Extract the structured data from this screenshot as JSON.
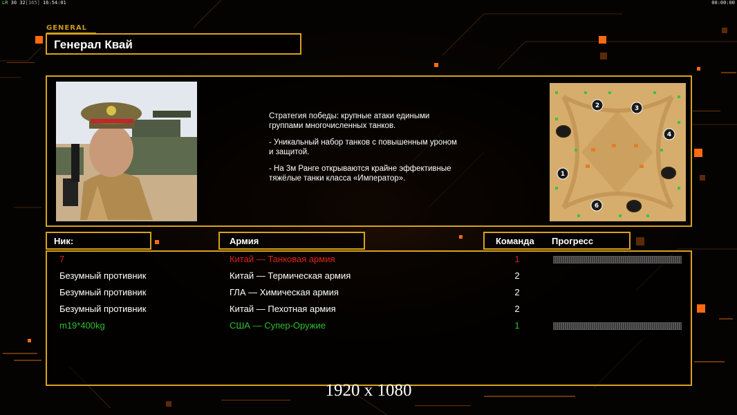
{
  "hud": {
    "fps_label": "LR",
    "fps": "30",
    "ping": "32",
    "ping_extra": "[165]",
    "clock": "16:54:01",
    "timer": "00:00:00"
  },
  "general": {
    "tag": "GENERAL",
    "name": "Генерал Квай",
    "description": [
      "Стратегия победы: крупные атаки едиными\n группами многочисленных танков.",
      "- Уникальный набор танков с повышенным уроном\n и защитой.",
      "- На 3м Ранге открываются крайне эффективные\n тяжёлые танки класса «Император»."
    ]
  },
  "minimap": {
    "slot_numbers": [
      "1",
      "2",
      "3",
      "4",
      "6"
    ]
  },
  "columns": {
    "nick": "Ник:",
    "army": "Армия",
    "team": "Команда",
    "progress": "Прогресс"
  },
  "players": [
    {
      "nick": "7",
      "army": "Китай — Танковая армия",
      "team": "1",
      "color": "#e0201a",
      "progress": 0
    },
    {
      "nick": "Безумный противник",
      "army": "Китай — Термическая армия",
      "team": "2",
      "color": "#ffffff"
    },
    {
      "nick": "Безумный противник",
      "army": "ГЛА — Химическая армия",
      "team": "2",
      "color": "#ffffff"
    },
    {
      "nick": "Безумный противник",
      "army": "Китай — Пехотная армия",
      "team": "2",
      "color": "#ffffff"
    },
    {
      "nick": "m19*400kg",
      "army": "США — Супер-Оружие",
      "team": "1",
      "color": "#2fbf2f",
      "progress": 0
    }
  ],
  "overlay": {
    "resolution": "1920 x 1080"
  },
  "colors": {
    "frame_gold": "#d8a21e",
    "accent_orange": "#ff7a12"
  }
}
